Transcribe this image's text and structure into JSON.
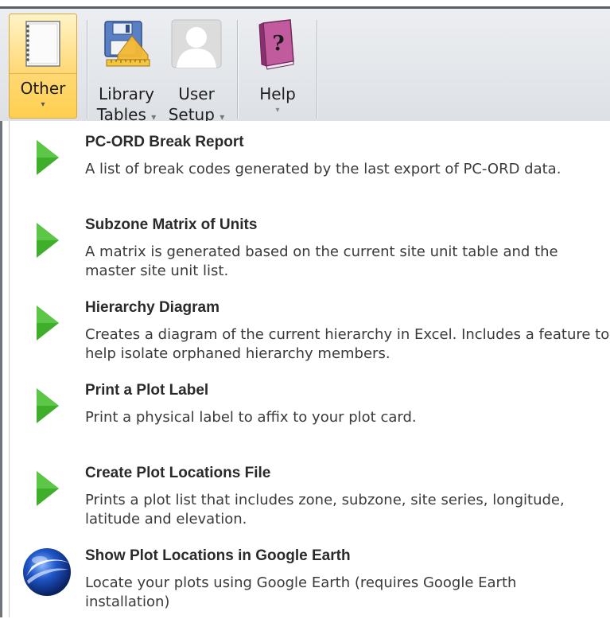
{
  "ribbon": {
    "buttons": [
      {
        "id": "other",
        "label_line1": "Other",
        "label_line2": "",
        "icon": "notepad-icon",
        "has_dropdown": true,
        "active": true
      },
      {
        "id": "library-tables",
        "label_line1": "Library",
        "label_line2": "Tables",
        "icon": "floppy-ruler-icon",
        "has_dropdown": true
      },
      {
        "id": "user-setup",
        "label_line1": "User",
        "label_line2": "Setup",
        "icon": "user-silhouette-icon",
        "has_dropdown": true
      },
      {
        "id": "help",
        "label_line1": "Help",
        "label_line2": "",
        "icon": "help-book-icon",
        "has_dropdown": true
      }
    ],
    "caret_glyph": "▾"
  },
  "menu": {
    "items": [
      {
        "title": "PC-ORD Break Report",
        "description": "A list of break codes generated by the last export of PC-ORD data.",
        "icon": "green-play-arrow-icon"
      },
      {
        "title": "Subzone Matrix of Units",
        "description": "A matrix is generated based on the current site unit table and the master site unit list.",
        "icon": "green-play-arrow-icon"
      },
      {
        "title": "Hierarchy Diagram",
        "description": "Creates a diagram of the current hierarchy in Excel.  Includes a feature to help isolate orphaned hierarchy members.",
        "icon": "green-play-arrow-icon"
      },
      {
        "title": "Print a Plot Label",
        "description": "Print a physical label to affix to your plot card.",
        "icon": "green-play-arrow-icon"
      },
      {
        "title": "Create Plot Locations File",
        "description": "Prints a plot list that includes zone, subzone, site series, longitude, latitude and elevation.",
        "icon": "green-play-arrow-icon"
      },
      {
        "title": "Show Plot Locations in Google Earth",
        "description": "Locate your plots using Google Earth (requires Google Earth installation)",
        "icon": "google-earth-icon"
      }
    ]
  },
  "colors": {
    "arrow_green": "#3fae2a",
    "active_button": "#ffd977",
    "ribbon_bg": "#e3e6ea"
  }
}
